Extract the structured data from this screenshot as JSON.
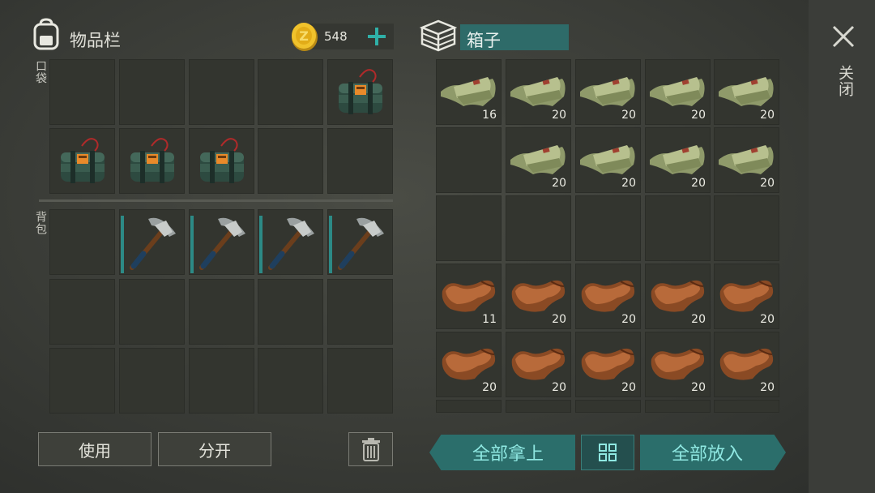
{
  "inventory": {
    "title": "物品栏",
    "coins": "548",
    "pocket_label": "口袋",
    "backpack_label": "背包"
  },
  "container": {
    "title": "箱子"
  },
  "close": {
    "label": "关闭"
  },
  "buttons": {
    "use": "使用",
    "split": "分开",
    "take_all": "全部拿上",
    "put_all": "全部放入"
  },
  "icons": {
    "backpack": "backpack-icon",
    "coin": "coin-icon",
    "add": "plus-icon",
    "box": "crate-icon",
    "close": "close-icon",
    "trash": "trash-icon",
    "sort": "grid-sort-icon"
  },
  "pocket_items": [
    "",
    "",
    "",
    "",
    "c4-explosive",
    "c4-explosive",
    "c4-explosive",
    "c4-explosive",
    "",
    ""
  ],
  "backpack_items": [
    "",
    "pickaxe",
    "pickaxe",
    "pickaxe",
    "pickaxe",
    "",
    "",
    "",
    "",
    "",
    "",
    "",
    "",
    "",
    ""
  ],
  "box_items": [
    {
      "item": "cloth",
      "count": "16"
    },
    {
      "item": "cloth",
      "count": "20"
    },
    {
      "item": "cloth",
      "count": "20"
    },
    {
      "item": "cloth",
      "count": "20"
    },
    {
      "item": "cloth",
      "count": "20"
    },
    {
      "item": "",
      "count": ""
    },
    {
      "item": "cloth",
      "count": "20"
    },
    {
      "item": "cloth",
      "count": "20"
    },
    {
      "item": "cloth",
      "count": "20"
    },
    {
      "item": "cloth",
      "count": "20"
    },
    {
      "item": "",
      "count": ""
    },
    {
      "item": "",
      "count": ""
    },
    {
      "item": "",
      "count": ""
    },
    {
      "item": "",
      "count": ""
    },
    {
      "item": "",
      "count": ""
    },
    {
      "item": "leather",
      "count": "11"
    },
    {
      "item": "leather",
      "count": "20"
    },
    {
      "item": "leather",
      "count": "20"
    },
    {
      "item": "leather",
      "count": "20"
    },
    {
      "item": "leather",
      "count": "20"
    },
    {
      "item": "leather",
      "count": "20"
    },
    {
      "item": "leather",
      "count": "20"
    },
    {
      "item": "leather",
      "count": "20"
    },
    {
      "item": "leather",
      "count": "20"
    },
    {
      "item": "leather",
      "count": "20"
    }
  ]
}
